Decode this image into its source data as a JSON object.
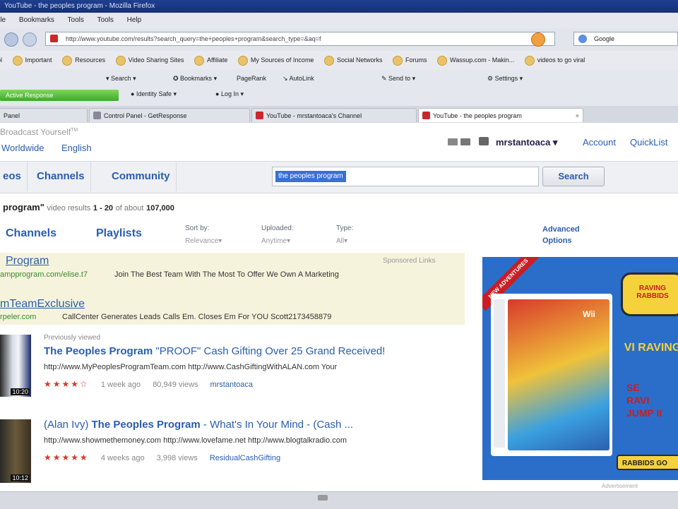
{
  "window": {
    "title": "YouTube - the peoples program - Mozilla Firefox"
  },
  "menu": [
    "File",
    "Bookmarks",
    "Tools",
    "Tools",
    "Help"
  ],
  "address": {
    "url": "http://www.youtube.com/results?search_query=the+peoples+program&search_type=&aq=f",
    "search_engine": "Google"
  },
  "bookmarks": [
    "Important",
    "Resources",
    "Video Sharing Sites",
    "Affiliate",
    "My Sources of Income",
    "Social Networks",
    "Forums",
    "Wassup.com - Makin...",
    "videos to go viral"
  ],
  "toolbar2": {
    "search": "Search",
    "bookmarks": "Bookmarks",
    "pagerank": "PageRank",
    "autolink": "AutoLink",
    "send_to": "Send to",
    "settings": "Settings"
  },
  "toolbar3": {
    "green": "Active Response",
    "identity": "Identity Safe",
    "log_in": "Log In"
  },
  "tabs": [
    {
      "label": "Panel"
    },
    {
      "label": "Control Panel - GetResponse"
    },
    {
      "label": "YouTube - mrstantoaca's Channel"
    },
    {
      "label": "YouTube - the peoples program"
    }
  ],
  "youtube": {
    "slogan": "Broadcast Yourself",
    "tm": "TM",
    "worldwide": "Worldwide",
    "language": "English",
    "username": "mrstantoaca",
    "account": "Account",
    "quicklist": "QuickList",
    "nav": [
      "Videos",
      "Channels",
      "Community"
    ],
    "nav_display": [
      "eos",
      "Channels",
      "Community"
    ],
    "query": "the peoples program",
    "search_button": "Search"
  },
  "results": {
    "query_tail": "program\"",
    "label": "video results",
    "range": "1 - 20",
    "of_about": "of about",
    "total": "107,000",
    "tabs": [
      "Channels",
      "Playlists"
    ],
    "sort_by_label": "Sort by:",
    "sort_by_value": "Relevance",
    "uploaded_label": "Uploaded:",
    "uploaded_value": "Anytime",
    "type_label": "Type:",
    "type_value": "All",
    "advanced": "Advanced Options"
  },
  "sponsored": {
    "label": "Sponsored Links",
    "ads": [
      {
        "title": "Program",
        "url": "ampprogram.com/elise.t7",
        "text": "Join The Best Team With The Most To Offer We Own A Marketing"
      },
      {
        "title": "mTeamExclusive",
        "url": "rpeler.com",
        "text": "CallCenter Generates Leads Calls Em. Closes Em For YOU Scott2173458879"
      }
    ]
  },
  "videos": [
    {
      "badge": "Previously viewed",
      "title_bold": "The Peoples Program",
      "title_rest": " \"PROOF\" Cash Gifting Over 25 Grand Received!",
      "urls": "http://www.MyPeoplesProgramTeam.com http://www.CashGiftingWithALAN.com Your",
      "rating": 4,
      "age": "1 week ago",
      "views": "80,949 views",
      "author": "mrstantoaca",
      "duration": "10:20"
    },
    {
      "badge": "",
      "title_prefix": "(Alan Ivy) ",
      "title_bold": "The Peoples Program",
      "title_rest": " - What's In Your Mind - (Cash ...",
      "urls": "http://www.showmethemoney.com http://www.lovefame.net http://www.blogtalkradio.com",
      "rating": 5,
      "age": "4 weeks ago",
      "views": "3,998 views",
      "author": "ResidualCashGifting",
      "duration": "10:12"
    }
  ],
  "banner": {
    "ribbon": "NEW ADVENTURES",
    "logo": "RAVING RABBIDS",
    "platform": "Wii",
    "headline": "VI RAVING",
    "cta_lines": [
      "SE",
      "RAVI",
      "JUMP II"
    ],
    "button": "RABBIDS GO",
    "advertisement": "Advertisement"
  },
  "colors": {
    "link": "#2a5db0",
    "sponsored_bg": "#f6f3dc",
    "banner_bg": "#2b6ec9",
    "title_bar": "#13307a"
  }
}
